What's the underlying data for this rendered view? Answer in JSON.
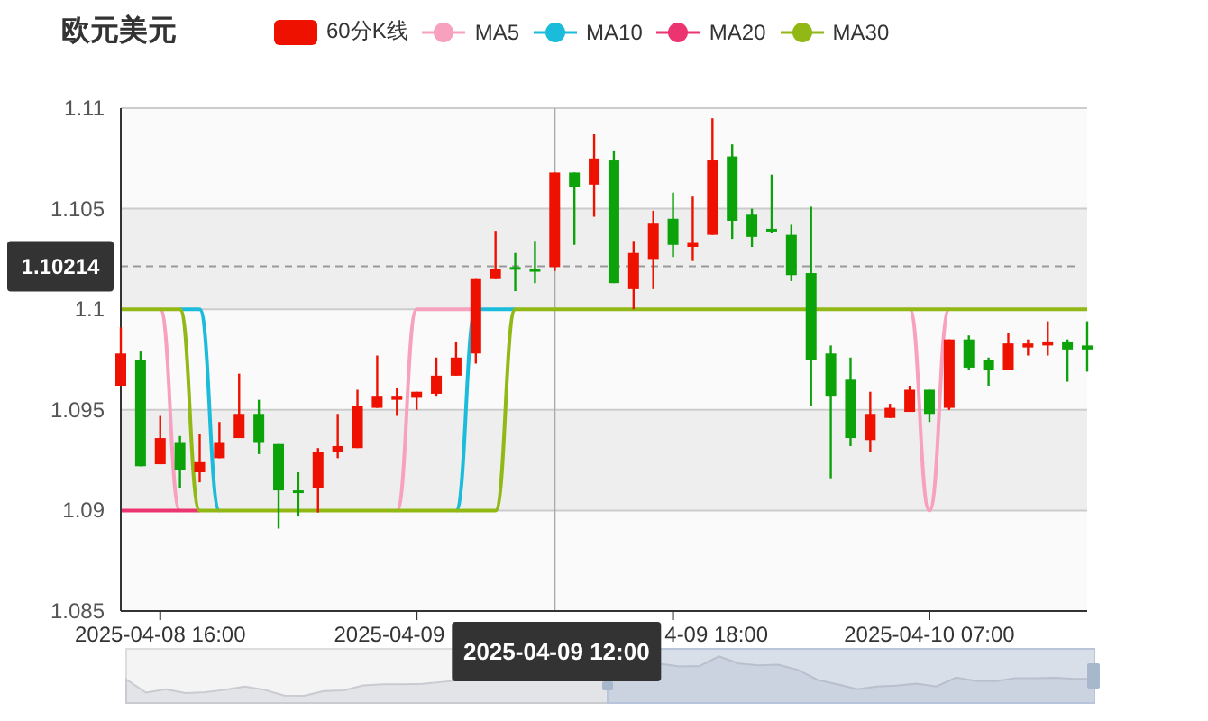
{
  "title": "欧元美元",
  "candle_legend": {
    "name": "60分K线"
  },
  "candle_styles": [
    {
      "kind": "up",
      "color": "#ee1100"
    },
    {
      "kind": "down",
      "color": "#0ca30a"
    }
  ],
  "chart_data": {
    "type": "candlestick",
    "grid": true,
    "ylim": [
      1.085,
      1.11
    ],
    "yticks": [
      1.11,
      1.105,
      1.1,
      1.095,
      1.09,
      1.085
    ],
    "categories": [
      null,
      null,
      "2025-04-08 16:00",
      null,
      null,
      null,
      null,
      null,
      null,
      null,
      null,
      null,
      null,
      null,
      null,
      null,
      null,
      null,
      null,
      null,
      null,
      null,
      "2025-04-09 12:00",
      null,
      null,
      null,
      null,
      null,
      null,
      null,
      null,
      null,
      null,
      null,
      null,
      null,
      null,
      null,
      null,
      null,
      null,
      "2025-04-10 07:00",
      null,
      null,
      null,
      null,
      null,
      null,
      null,
      null
    ],
    "ohlc": [
      [
        1.0962,
        1.0991,
        1.0962,
        1.0978
      ],
      [
        1.0975,
        1.0979,
        1.0922,
        1.0922
      ],
      [
        1.0923,
        1.0947,
        1.0923,
        1.0936
      ],
      [
        1.0934,
        1.0937,
        1.0911,
        1.092
      ],
      [
        1.0919,
        1.0938,
        1.0914,
        1.0924
      ],
      [
        1.0926,
        1.0944,
        1.0926,
        1.0934
      ],
      [
        1.0936,
        1.0968,
        1.0936,
        1.0948
      ],
      [
        1.0948,
        1.0955,
        1.0928,
        1.0934
      ],
      [
        1.0933,
        1.0933,
        1.0891,
        1.091
      ],
      [
        1.091,
        1.0919,
        1.0897,
        1.0909
      ],
      [
        1.0911,
        1.0931,
        1.0899,
        1.0929
      ],
      [
        1.0929,
        1.0948,
        1.0926,
        1.0932
      ],
      [
        1.0931,
        1.096,
        1.0931,
        1.0952
      ],
      [
        1.0951,
        1.0977,
        1.0951,
        1.0957
      ],
      [
        1.0955,
        1.0961,
        1.0947,
        1.0957
      ],
      [
        1.0956,
        1.0959,
        1.095,
        1.0959
      ],
      [
        1.0958,
        1.0976,
        1.0957,
        1.0967
      ],
      [
        1.0967,
        1.0984,
        1.0967,
        1.0976
      ],
      [
        1.0978,
        1.1015,
        1.0973,
        1.1015
      ],
      [
        1.1015,
        1.1039,
        1.1015,
        1.102
      ],
      [
        1.1021,
        1.1028,
        1.1009,
        1.102
      ],
      [
        1.102,
        1.1034,
        1.1013,
        1.1019
      ],
      [
        1.1021,
        1.1068,
        1.1019,
        1.1068
      ],
      [
        1.1068,
        1.1068,
        1.1032,
        1.1061
      ],
      [
        1.1062,
        1.1087,
        1.1046,
        1.1075
      ],
      [
        1.1074,
        1.1079,
        1.1013,
        1.1013
      ],
      [
        1.101,
        1.1034,
        1.1,
        1.1028
      ],
      [
        1.1025,
        1.1049,
        1.101,
        1.1043
      ],
      [
        1.1045,
        1.1058,
        1.1026,
        1.1032
      ],
      [
        1.1031,
        1.1056,
        1.1024,
        1.1033
      ],
      [
        1.1037,
        1.1095,
        1.1037,
        1.1074
      ],
      [
        1.1076,
        1.1082,
        1.1035,
        1.1044
      ],
      [
        1.1047,
        1.105,
        1.1031,
        1.1036
      ],
      [
        1.104,
        1.1067,
        1.1038,
        1.1039
      ],
      [
        1.1037,
        1.1042,
        1.1014,
        1.1017
      ],
      [
        1.1018,
        1.1051,
        1.0952,
        1.0975
      ],
      [
        1.0978,
        1.0982,
        1.0916,
        1.0957
      ],
      [
        1.0965,
        1.0976,
        1.0932,
        1.0936
      ],
      [
        1.0935,
        1.0959,
        1.0929,
        1.0948
      ],
      [
        1.0946,
        1.0953,
        1.0946,
        1.0951
      ],
      [
        1.0949,
        1.0962,
        1.0949,
        1.096
      ],
      [
        1.096,
        1.096,
        1.0944,
        1.0948
      ],
      [
        1.0951,
        1.0985,
        1.095,
        1.0985
      ],
      [
        1.0985,
        1.0987,
        1.097,
        1.0971
      ],
      [
        1.0975,
        1.0976,
        1.0962,
        1.097
      ],
      [
        1.097,
        1.0988,
        1.097,
        1.0983
      ],
      [
        1.0981,
        1.0985,
        1.0977,
        1.0983
      ],
      [
        1.0982,
        1.0994,
        1.0977,
        1.0984
      ],
      [
        1.0984,
        1.0985,
        1.0964,
        1.098
      ],
      [
        1.0982,
        1.0994,
        1.0969,
        1.098
      ]
    ],
    "series": [
      {
        "name": "MA5",
        "type": "line",
        "color": "#f7a1be",
        "values": [
          null,
          null,
          1.1,
          1.09,
          null,
          null,
          null,
          null,
          null,
          null,
          null,
          null,
          null,
          null,
          1.09,
          1.1,
          1.1,
          1.1,
          1.1,
          null,
          null,
          null,
          null,
          null,
          null,
          null,
          null,
          null,
          null,
          null,
          null,
          null,
          null,
          null,
          null,
          null,
          null,
          null,
          null,
          null,
          1.1,
          1.09,
          1.1,
          null,
          null,
          null,
          null,
          null,
          null,
          null
        ]
      },
      {
        "name": "MA10",
        "type": "line",
        "color": "#1bbcdb",
        "values": [
          null,
          null,
          null,
          1.1,
          1.1,
          1.09,
          null,
          null,
          null,
          null,
          null,
          null,
          null,
          null,
          null,
          null,
          null,
          1.09,
          1.1,
          1.1,
          1.1,
          null,
          null,
          null,
          null,
          null,
          null,
          null,
          null,
          null,
          null,
          null,
          null,
          null,
          null,
          null,
          null,
          null,
          null,
          null,
          null,
          null,
          null,
          null,
          null,
          null,
          null,
          null,
          null,
          null
        ]
      },
      {
        "name": "MA20",
        "type": "line",
        "color": "#ec3470",
        "values": [
          1.09,
          1.09,
          1.09,
          1.09,
          1.09,
          null,
          null,
          null,
          null,
          null,
          null,
          null,
          null,
          null,
          null,
          null,
          null,
          null,
          null,
          null,
          null,
          null,
          null,
          null,
          null,
          null,
          null,
          null,
          null,
          null,
          null,
          null,
          null,
          null,
          null,
          null,
          null,
          null,
          null,
          null,
          null,
          null,
          null,
          null,
          null,
          null,
          null,
          null,
          null,
          null
        ]
      },
      {
        "name": "MA30",
        "type": "line",
        "color": "#91b814",
        "values": [
          1.1,
          1.1,
          1.1,
          1.1,
          1.09,
          1.09,
          1.09,
          1.09,
          1.09,
          1.09,
          1.09,
          1.09,
          1.09,
          1.09,
          1.09,
          1.09,
          1.09,
          1.09,
          1.09,
          1.09,
          1.1,
          1.1,
          1.1,
          1.1,
          1.1,
          1.1,
          1.1,
          1.1,
          1.1,
          1.1,
          1.1,
          1.1,
          1.1,
          1.1,
          1.1,
          1.1,
          1.1,
          1.1,
          1.1,
          1.1,
          1.1,
          1.1,
          1.1,
          1.1,
          1.1,
          1.1,
          1.1,
          1.1,
          1.1,
          1.1
        ]
      }
    ],
    "ref_lines": [
      {
        "axis": "y",
        "value": 1.10214,
        "label": "1.10214"
      },
      {
        "axis": "x",
        "value": "2025-04-09 12:00"
      }
    ]
  },
  "covered_axis_labels": [
    "2025-04-09",
    "4-09 18:00"
  ]
}
